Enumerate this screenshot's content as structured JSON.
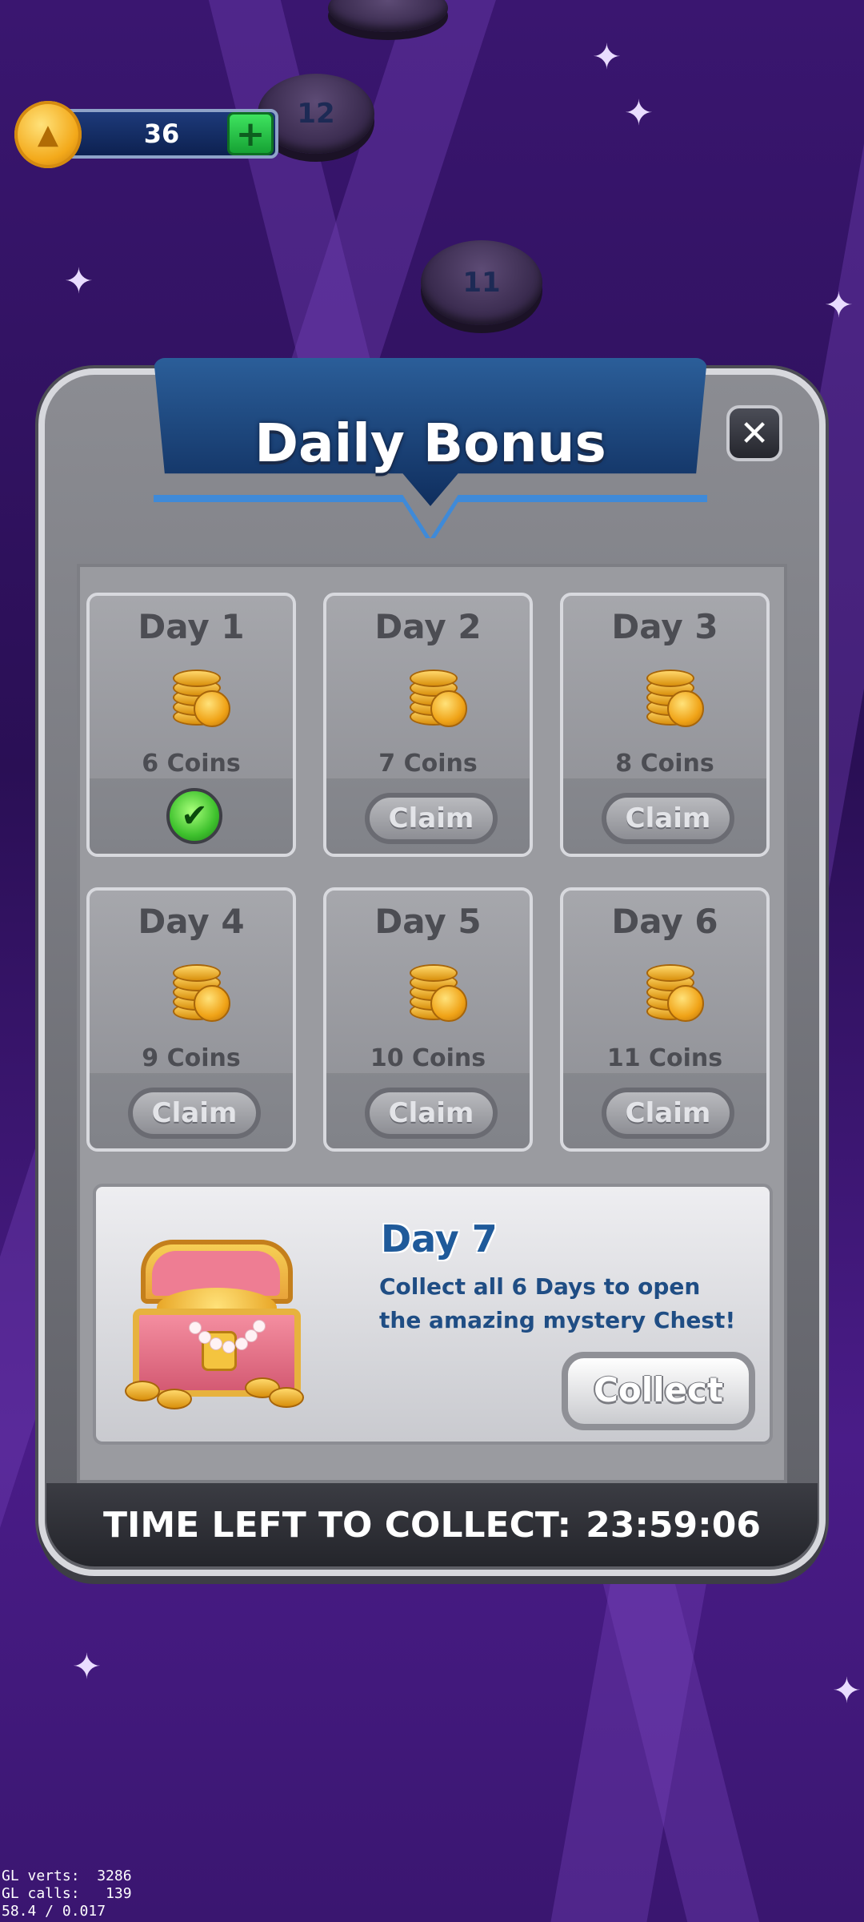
{
  "hud": {
    "coins": "36",
    "plus_label": "+"
  },
  "map": {
    "node_12": "12",
    "node_11": "11"
  },
  "dialog": {
    "title": "Daily Bonus",
    "close_label": "✕",
    "days": [
      {
        "label": "Day 1",
        "amount": "6 Coins",
        "state": "claimed"
      },
      {
        "label": "Day 2",
        "amount": "7 Coins",
        "state": "claim",
        "button": "Claim"
      },
      {
        "label": "Day 3",
        "amount": "8 Coins",
        "state": "claim",
        "button": "Claim"
      },
      {
        "label": "Day 4",
        "amount": "9 Coins",
        "state": "claim",
        "button": "Claim"
      },
      {
        "label": "Day 5",
        "amount": "10 Coins",
        "state": "claim",
        "button": "Claim"
      },
      {
        "label": "Day 6",
        "amount": "11 Coins",
        "state": "claim",
        "button": "Claim"
      }
    ],
    "day7": {
      "title": "Day 7",
      "description": "Collect all 6 Days to open the amazing mystery Chest!",
      "button": "Collect"
    },
    "timer_label": "TIME LEFT TO COLLECT:",
    "timer_value": "23:59:06"
  },
  "debug": {
    "line1": "GL verts:  3286",
    "line2": "GL calls:   139",
    "line3": "58.4 / 0.017"
  },
  "colors": {
    "banner": "#0f2e5e",
    "accent_blue": "#1f5a9a",
    "claim_green": "#3ec12d",
    "coin_gold": "#f3a91a"
  }
}
